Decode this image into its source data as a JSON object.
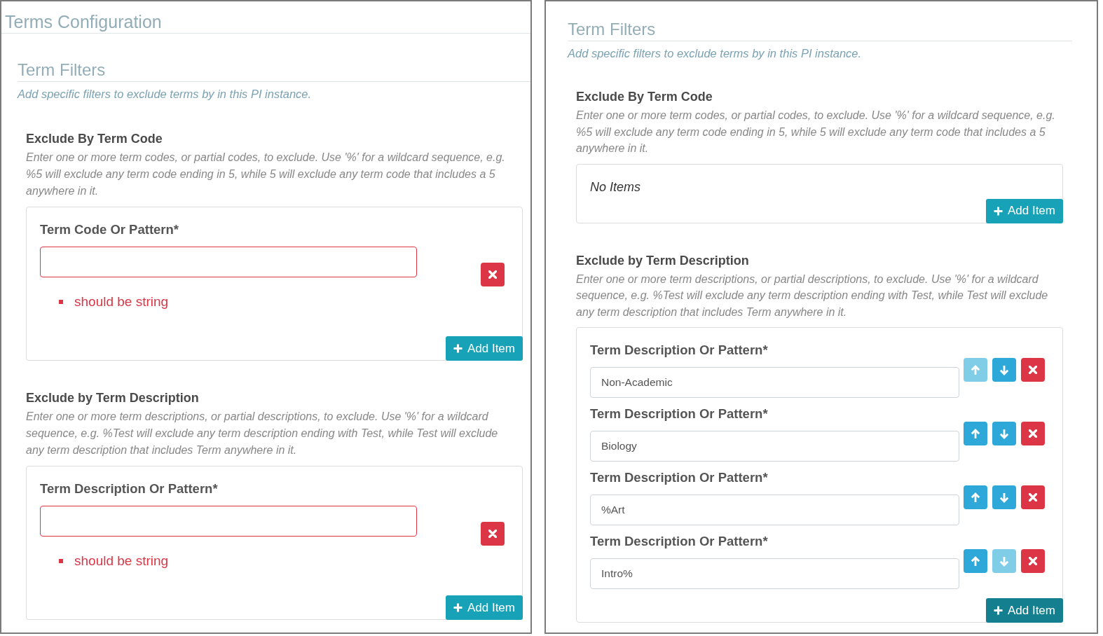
{
  "panels": [
    {
      "title": "Terms Configuration",
      "section": {
        "title": "Term Filters",
        "subtitle": "Add specific filters to exclude terms by in this PI instance.",
        "groups": [
          {
            "title": "Exclude By Term Code",
            "description": "Enter one or more term codes, or partial codes, to exclude. Use '%' for a wildcard sequence, e.g. %5 will exclude any term code ending in 5, while 5 will exclude any term code that includes a 5 anywhere in it.",
            "items": [
              {
                "label": "Term Code Or Pattern*",
                "invalid": true,
                "errors": [
                  "should be string"
                ],
                "controls": [
                  {
                    "kind": "delete",
                    "disabled": false
                  }
                ]
              }
            ],
            "add_button": {
              "label": "Add Item",
              "focused": false
            }
          },
          {
            "title": "Exclude by Term Description",
            "description": "Enter one or more term descriptions, or partial descriptions, to exclude. Use '%' for a wildcard sequence, e.g. %Test will exclude any term description ending with Test, while Test will exclude any term description that includes Term anywhere in it.",
            "items": [
              {
                "label": "Term Description Or Pattern*",
                "invalid": true,
                "errors": [
                  "should be string"
                ],
                "controls": [
                  {
                    "kind": "delete",
                    "disabled": false
                  }
                ]
              }
            ],
            "add_button": {
              "label": "Add Item",
              "focused": false
            }
          }
        ]
      }
    },
    {
      "section": {
        "title": "Term Filters",
        "subtitle": "Add specific filters to exclude terms by in this PI instance.",
        "groups": [
          {
            "title": "Exclude By Term Code",
            "description": "Enter one or more term codes, or partial codes, to exclude. Use '%' for a wildcard sequence, e.g. %5 will exclude any term code ending in 5, while 5 will exclude any term code that includes a 5 anywhere in it.",
            "empty_text": "No Items",
            "add_button": {
              "label": "Add Item",
              "focused": false
            }
          },
          {
            "title": "Exclude by Term Description",
            "description": "Enter one or more term descriptions, or partial descriptions, to exclude. Use '%' for a wildcard sequence, e.g. %Test will exclude any term description ending with Test, while Test will exclude any term description that includes Term anywhere in it.",
            "items": [
              {
                "label": "Term Description Or Pattern*",
                "value": "Non-Academic",
                "invalid": false,
                "controls": [
                  {
                    "kind": "up",
                    "disabled": true
                  },
                  {
                    "kind": "down",
                    "disabled": false
                  },
                  {
                    "kind": "delete",
                    "disabled": false
                  }
                ]
              },
              {
                "label": "Term Description Or Pattern*",
                "value": "Biology",
                "invalid": false,
                "controls": [
                  {
                    "kind": "up",
                    "disabled": false
                  },
                  {
                    "kind": "down",
                    "disabled": false
                  },
                  {
                    "kind": "delete",
                    "disabled": false
                  }
                ]
              },
              {
                "label": "Term Description Or Pattern*",
                "value": "%Art",
                "invalid": false,
                "controls": [
                  {
                    "kind": "up",
                    "disabled": false
                  },
                  {
                    "kind": "down",
                    "disabled": false
                  },
                  {
                    "kind": "delete",
                    "disabled": false
                  }
                ]
              },
              {
                "label": "Term Description Or Pattern*",
                "value": "Intro%",
                "invalid": false,
                "controls": [
                  {
                    "kind": "up",
                    "disabled": false
                  },
                  {
                    "kind": "down",
                    "disabled": true
                  },
                  {
                    "kind": "delete",
                    "disabled": false
                  }
                ]
              }
            ],
            "add_button": {
              "label": "Add Item",
              "focused": true
            }
          }
        ]
      }
    }
  ]
}
